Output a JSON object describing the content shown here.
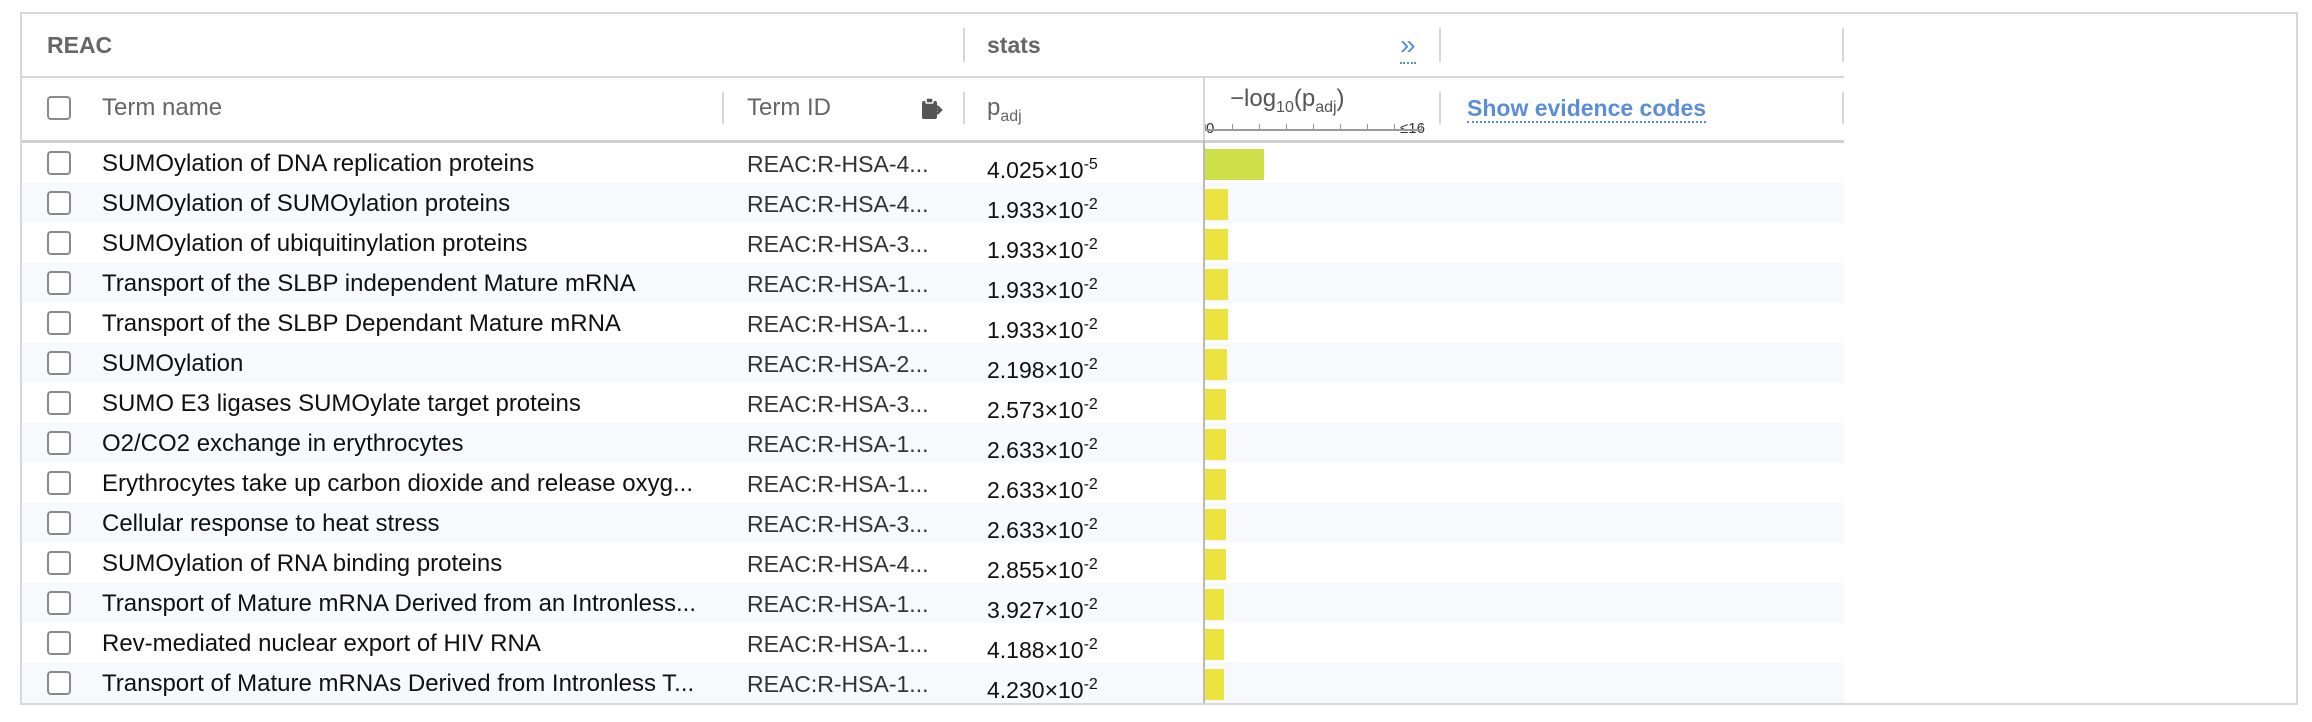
{
  "header": {
    "group_source": "REAC",
    "group_stats": "stats",
    "expand_glyph": "»"
  },
  "columns": {
    "term_name": "Term name",
    "term_id": "Term ID",
    "padj": "p",
    "padj_sub": "adj",
    "bar_label_prefix": "−log",
    "bar_label_base": "10",
    "bar_label_p": "(p",
    "bar_label_sub": "adj",
    "bar_label_close": ")",
    "axis_min": "0",
    "axis_max": "≤16",
    "evidence": "Show evidence codes"
  },
  "rows": [
    {
      "name": "SUMOylation of DNA replication proteins",
      "id": "REAC:R-HSA-4...",
      "mant": "4.025",
      "exp": "-5",
      "neglog": 4.395
    },
    {
      "name": "SUMOylation of SUMOylation proteins",
      "id": "REAC:R-HSA-4...",
      "mant": "1.933",
      "exp": "-2",
      "neglog": 1.714
    },
    {
      "name": "SUMOylation of ubiquitinylation proteins",
      "id": "REAC:R-HSA-3...",
      "mant": "1.933",
      "exp": "-2",
      "neglog": 1.714
    },
    {
      "name": "Transport of the SLBP independent Mature mRNA",
      "id": "REAC:R-HSA-1...",
      "mant": "1.933",
      "exp": "-2",
      "neglog": 1.714
    },
    {
      "name": "Transport of the SLBP Dependant Mature mRNA",
      "id": "REAC:R-HSA-1...",
      "mant": "1.933",
      "exp": "-2",
      "neglog": 1.714
    },
    {
      "name": "SUMOylation",
      "id": "REAC:R-HSA-2...",
      "mant": "2.198",
      "exp": "-2",
      "neglog": 1.658
    },
    {
      "name": "SUMO E3 ligases SUMOylate target proteins",
      "id": "REAC:R-HSA-3...",
      "mant": "2.573",
      "exp": "-2",
      "neglog": 1.59
    },
    {
      "name": "O2/CO2 exchange in erythrocytes",
      "id": "REAC:R-HSA-1...",
      "mant": "2.633",
      "exp": "-2",
      "neglog": 1.58
    },
    {
      "name": "Erythrocytes take up carbon dioxide and release oxyg...",
      "id": "REAC:R-HSA-1...",
      "mant": "2.633",
      "exp": "-2",
      "neglog": 1.58
    },
    {
      "name": "Cellular response to heat stress",
      "id": "REAC:R-HSA-3...",
      "mant": "2.633",
      "exp": "-2",
      "neglog": 1.58
    },
    {
      "name": "SUMOylation of RNA binding proteins",
      "id": "REAC:R-HSA-4...",
      "mant": "2.855",
      "exp": "-2",
      "neglog": 1.544
    },
    {
      "name": "Transport of Mature mRNA Derived from an Intronless...",
      "id": "REAC:R-HSA-1...",
      "mant": "3.927",
      "exp": "-2",
      "neglog": 1.406
    },
    {
      "name": "Rev-mediated nuclear export of HIV RNA",
      "id": "REAC:R-HSA-1...",
      "mant": "4.188",
      "exp": "-2",
      "neglog": 1.378
    },
    {
      "name": "Transport of Mature mRNAs Derived from Intronless T...",
      "id": "REAC:R-HSA-1...",
      "mant": "4.230",
      "exp": "-2",
      "neglog": 1.374
    }
  ],
  "colors": {
    "bar": "#ece33e",
    "bar_top": "#cde04a",
    "link": "#5b8dd9"
  }
}
